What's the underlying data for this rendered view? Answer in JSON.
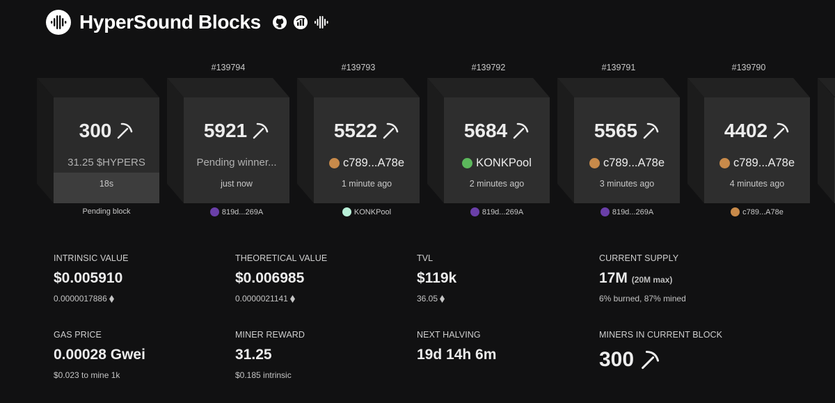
{
  "app": {
    "title": "HyperSound Blocks"
  },
  "header_icons": [
    "github-icon",
    "chart-icon",
    "hypersound-icon"
  ],
  "pending_block": {
    "count": "300",
    "reward": "31.25 $HYPERS",
    "timer": "18s",
    "label": "Pending block"
  },
  "blocks": [
    {
      "number": "#139794",
      "count": "5921",
      "winner": "Pending winner...",
      "time": "just now",
      "miner": "819d...269A",
      "winner_color": "",
      "miner_color": "#6a3fa8"
    },
    {
      "number": "#139793",
      "count": "5522",
      "winner": "c789...A78e",
      "time": "1 minute ago",
      "miner": "KONKPool",
      "winner_color": "#c88a4a",
      "miner_color": "#b9f0d8"
    },
    {
      "number": "#139792",
      "count": "5684",
      "winner": "KONKPool",
      "time": "2 minutes ago",
      "miner": "819d...269A",
      "winner_color": "#5cb85c",
      "miner_color": "#6a3fa8"
    },
    {
      "number": "#139791",
      "count": "5565",
      "winner": "c789...A78e",
      "time": "3 minutes ago",
      "miner": "819d...269A",
      "winner_color": "#c88a4a",
      "miner_color": "#6a3fa8"
    },
    {
      "number": "#139790",
      "count": "4402",
      "winner": "c789...A78e",
      "time": "4 minutes ago",
      "miner": "c789...A78e",
      "winner_color": "#c88a4a",
      "miner_color": "#c88a4a"
    }
  ],
  "stats": {
    "intrinsic": {
      "label": "INTRINSIC VALUE",
      "value": "$0.005910",
      "sub": "0.0000017886"
    },
    "theoretical": {
      "label": "THEORETICAL VALUE",
      "value": "$0.006985",
      "sub": "0.0000021141"
    },
    "tvl": {
      "label": "TVL",
      "value": "$119k",
      "sub": "36.05"
    },
    "supply": {
      "label": "CURRENT SUPPLY",
      "value": "17M",
      "value_note": "(20M max)",
      "sub": "6% burned, 87% mined"
    },
    "gas": {
      "label": "GAS PRICE",
      "value": "0.00028 Gwei",
      "sub": "$0.023 to mine 1k"
    },
    "reward": {
      "label": "MINER REWARD",
      "value": "31.25",
      "sub": "$0.185 intrinsic"
    },
    "halving": {
      "label": "NEXT HALVING",
      "value": "19d 14h 6m"
    },
    "miners": {
      "label": "MINERS IN CURRENT BLOCK",
      "value": "300"
    }
  }
}
